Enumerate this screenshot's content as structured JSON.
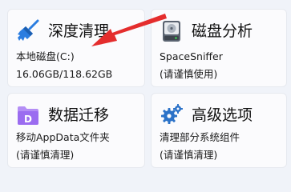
{
  "cards": [
    {
      "title": "深度清理",
      "line1": "本地磁盘(C:)",
      "line2": "16.06GB/118.62GB",
      "icon": "broom-icon",
      "accent": "#2b7de0"
    },
    {
      "title": "磁盘分析",
      "line1": "SpaceSniffer",
      "line2": "(请谨慎使用)",
      "icon": "hard-drive-icon",
      "accent": "#5a6370"
    },
    {
      "title": "数据迁移",
      "line1": "移动AppData文件夹",
      "line2": "(请谨慎清理)",
      "icon": "folder-d-icon",
      "accent": "#9b6cf0"
    },
    {
      "title": "高级选项",
      "line1": "清理部分系统组件",
      "line2": "(请谨慎清理)",
      "icon": "gears-icon",
      "accent": "#2b72c8"
    }
  ],
  "annotation": {
    "arrow_color": "#e42d2d"
  }
}
